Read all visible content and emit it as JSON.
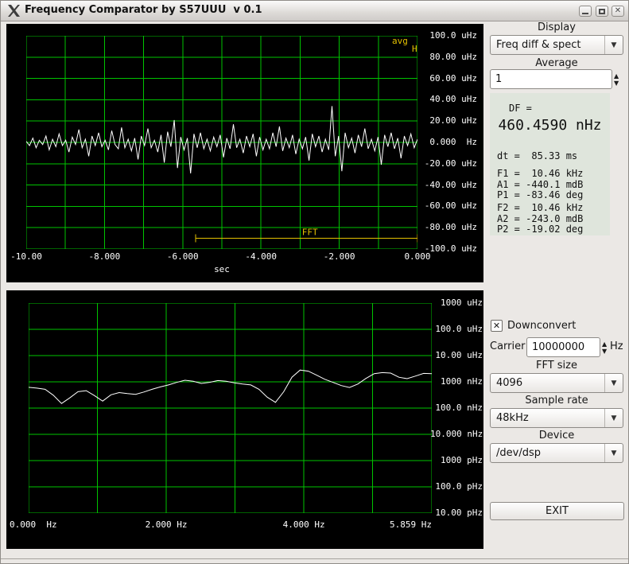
{
  "window": {
    "title": "Frequency Comparator by S57UUU  v 0.1",
    "icon": "x11-logo",
    "close_glyph": "✕"
  },
  "icons": {
    "combo_arrow": "▼",
    "spin_up": "▲",
    "spin_down": "▼",
    "check_mark": "✕"
  },
  "colors": {
    "grid_green": "#00c400",
    "trace_white": "#ffffff",
    "accent_yellow": "#e3c000",
    "plot_bg": "#000000",
    "info_bg": "#dfe5dc",
    "window_bg": "#ebe8e5"
  },
  "sidebar": {
    "display_label": "Display",
    "display_value": "Freq diff & spect",
    "average_label": "Average",
    "average_value": "1",
    "info": {
      "df_label": "DF =",
      "df_value": "460.4590 nHz",
      "groups": [
        [
          "dt =  85.33 ms"
        ],
        [
          "F1 =  10.46 kHz",
          "A1 = -440.1 mdB",
          "P1 = -83.46 deg"
        ],
        [
          "F2 =  10.46 kHz",
          "A2 = -243.0 mdB",
          "P2 = -19.02 deg"
        ]
      ]
    },
    "downconvert_label": "Downconvert",
    "downconvert_checked": true,
    "carrier_label": "Carrier",
    "carrier_value": "10000000",
    "carrier_unit": "Hz",
    "fft_size_label": "FFT size",
    "fft_size_value": "4096",
    "sample_rate_label": "Sample rate",
    "sample_rate_value": "48kHz",
    "device_label": "Device",
    "device_value": "/dev/dsp",
    "exit_label": "EXIT"
  },
  "chart_data": [
    {
      "type": "line",
      "name": "frequency-difference-vs-time",
      "xlabel": "sec",
      "x_range": [
        -10,
        0
      ],
      "x_grid_step": 1,
      "x_ticks": [
        {
          "v": -10,
          "label": "-10.00"
        },
        {
          "v": -8,
          "label": "-8.000"
        },
        {
          "v": -6,
          "label": "-6.000"
        },
        {
          "v": -4,
          "label": "-4.000"
        },
        {
          "v": -2,
          "label": "-2.000"
        },
        {
          "v": 0,
          "label": "0.000"
        }
      ],
      "y_range_uHz": [
        -100,
        100
      ],
      "y_grid_step_uHz": 20,
      "y_tick_labels": [
        "100.0 uHz",
        "80.00 uHz",
        "60.00 uHz",
        "40.00 uHz",
        "20.00 uHz",
        "0.000  Hz",
        "-20.00 uHz",
        "-40.00 uHz",
        "-60.00 uHz",
        "-80.00 uHz",
        "-100.0 uHz"
      ],
      "grid": true,
      "legend_position": "top-right",
      "annotations": {
        "avg": "avg",
        "hold": "H",
        "fft_label": "FFT",
        "fft_label_t": -2.75,
        "fft_window": {
          "t_start": -5.67,
          "t_end": 0,
          "level_uHz": -90
        }
      },
      "series": [
        {
          "name": "freq-diff",
          "unit": "uHz",
          "values": [
            1,
            -3,
            4,
            -5,
            2,
            -2,
            6,
            -7,
            3,
            -4,
            8,
            -3,
            2,
            -9,
            5,
            -2,
            12,
            -5,
            3,
            -13,
            6,
            -3,
            9,
            -4,
            2,
            -7,
            11,
            -2,
            -6,
            14,
            -5,
            3,
            -8,
            4,
            -16,
            6,
            -3,
            13,
            -5,
            2,
            -9,
            7,
            -19,
            10,
            -4,
            21,
            -24,
            5,
            -7,
            4,
            -29,
            8,
            -5,
            9,
            -6,
            3,
            -8,
            5,
            -4,
            7,
            -14,
            4,
            -6,
            17,
            -5,
            3,
            -10,
            6,
            -4,
            8,
            -13,
            5,
            -7,
            3,
            -6,
            9,
            -4,
            15,
            -8,
            4,
            -5,
            7,
            -11,
            3,
            -6,
            5,
            -17,
            8,
            -4,
            6,
            -9,
            3,
            -7,
            34,
            -13,
            6,
            -27,
            9,
            -5,
            4,
            -10,
            7,
            -4,
            13,
            -6,
            3,
            -8,
            5,
            -21,
            7,
            -4,
            9,
            -6,
            4,
            -15,
            6,
            -3,
            8,
            -5,
            3
          ]
        }
      ]
    },
    {
      "type": "line",
      "name": "spectrum-log",
      "x_range": [
        0,
        5.859
      ],
      "x_grid_step": 1,
      "x_ticks": [
        {
          "v": 0,
          "label": "0.000  Hz"
        },
        {
          "v": 2,
          "label": "2.000 Hz"
        },
        {
          "v": 4,
          "label": "4.000 Hz"
        },
        {
          "v": 5.859,
          "label": "5.859 Hz"
        }
      ],
      "y_scale": "log",
      "y_top_nHz": 1000000,
      "y_decades": 8,
      "y_tick_labels": [
        "1000 uHz",
        "100.0 uHz",
        "10.00 uHz",
        "1000 nHz",
        "100.0 nHz",
        "10.000 nHz",
        "1000 pHz",
        "100.0 pHz",
        "10.00 pHz"
      ],
      "grid": true,
      "series": [
        {
          "name": "spectrum",
          "unit": "nHz",
          "values": [
            620,
            575,
            520,
            310,
            150,
            245,
            420,
            460,
            300,
            185,
            320,
            390,
            355,
            335,
            410,
            520,
            640,
            760,
            950,
            1150,
            1050,
            870,
            960,
            1120,
            1060,
            920,
            820,
            760,
            520,
            260,
            165,
            420,
            1500,
            2800,
            2550,
            1800,
            1250,
            950,
            720,
            610,
            820,
            1350,
            2050,
            2250,
            2150,
            1500,
            1320,
            1650,
            2100,
            2050
          ]
        }
      ]
    }
  ]
}
